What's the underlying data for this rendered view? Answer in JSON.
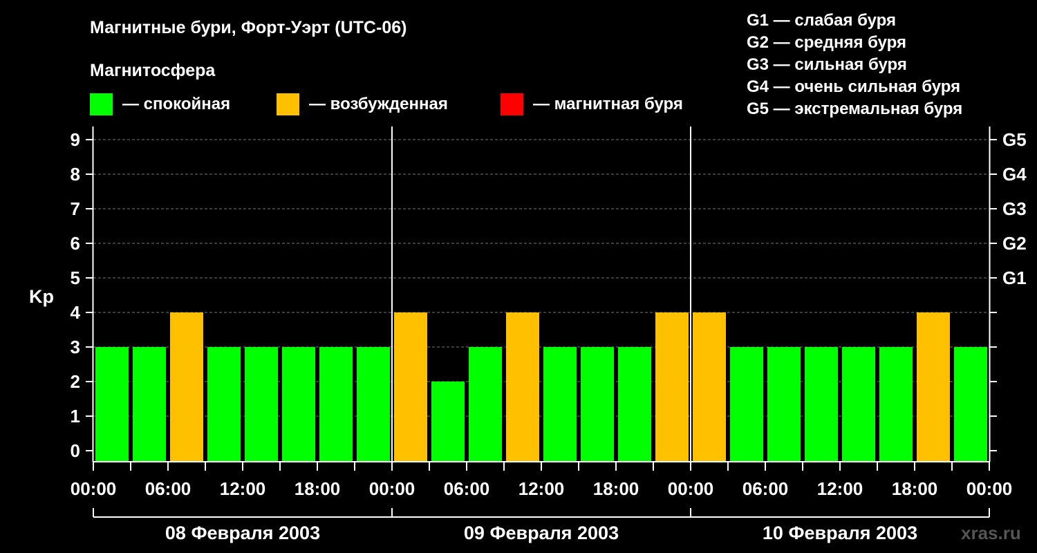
{
  "chart_data": {
    "type": "bar",
    "title": "Магнитные бури, Форт-Уэрт (UTC-06)",
    "legend_title": "Магнитосфера",
    "legend": [
      {
        "key": "quiet",
        "color": "#00ff00",
        "label": "— спокойная"
      },
      {
        "key": "active",
        "color": "#ffc000",
        "label": "— возбужденная"
      },
      {
        "key": "storm",
        "color": "#ff0000",
        "label": "— магнитная буря"
      }
    ],
    "storm_scale": [
      "G1 — слабая буря",
      "G2 — средняя буря",
      "G3 — сильная буря",
      "G4 — очень сильная буря",
      "G5 — экстремальная буря"
    ],
    "ylabel": "Kp",
    "ylim": [
      0,
      9
    ],
    "yticks": [
      "0",
      "1",
      "2",
      "3",
      "4",
      "5",
      "6",
      "7",
      "8",
      "9"
    ],
    "right_ticks": [
      {
        "value": 5,
        "label": "G1"
      },
      {
        "value": 6,
        "label": "G2"
      },
      {
        "value": 7,
        "label": "G3"
      },
      {
        "value": 8,
        "label": "G4"
      },
      {
        "value": 9,
        "label": "G5"
      }
    ],
    "grid": true,
    "x_tick_labels": [
      "00:00",
      "06:00",
      "12:00",
      "18:00",
      "00:00",
      "06:00",
      "12:00",
      "18:00",
      "00:00",
      "06:00",
      "12:00",
      "18:00",
      "00:00"
    ],
    "days": [
      "08 Февраля 2003",
      "09 Февраля 2003",
      "10 Февраля 2003"
    ],
    "interval_hours": 3,
    "values": [
      3,
      3,
      4,
      3,
      3,
      3,
      3,
      3,
      4,
      2,
      3,
      4,
      3,
      3,
      3,
      4,
      4,
      3,
      3,
      3,
      3,
      3,
      4,
      3
    ],
    "levels": [
      "quiet",
      "quiet",
      "active",
      "quiet",
      "quiet",
      "quiet",
      "quiet",
      "quiet",
      "active",
      "quiet",
      "quiet",
      "active",
      "quiet",
      "quiet",
      "quiet",
      "active",
      "active",
      "quiet",
      "quiet",
      "quiet",
      "quiet",
      "quiet",
      "active",
      "quiet"
    ]
  },
  "watermark": "xras.ru"
}
